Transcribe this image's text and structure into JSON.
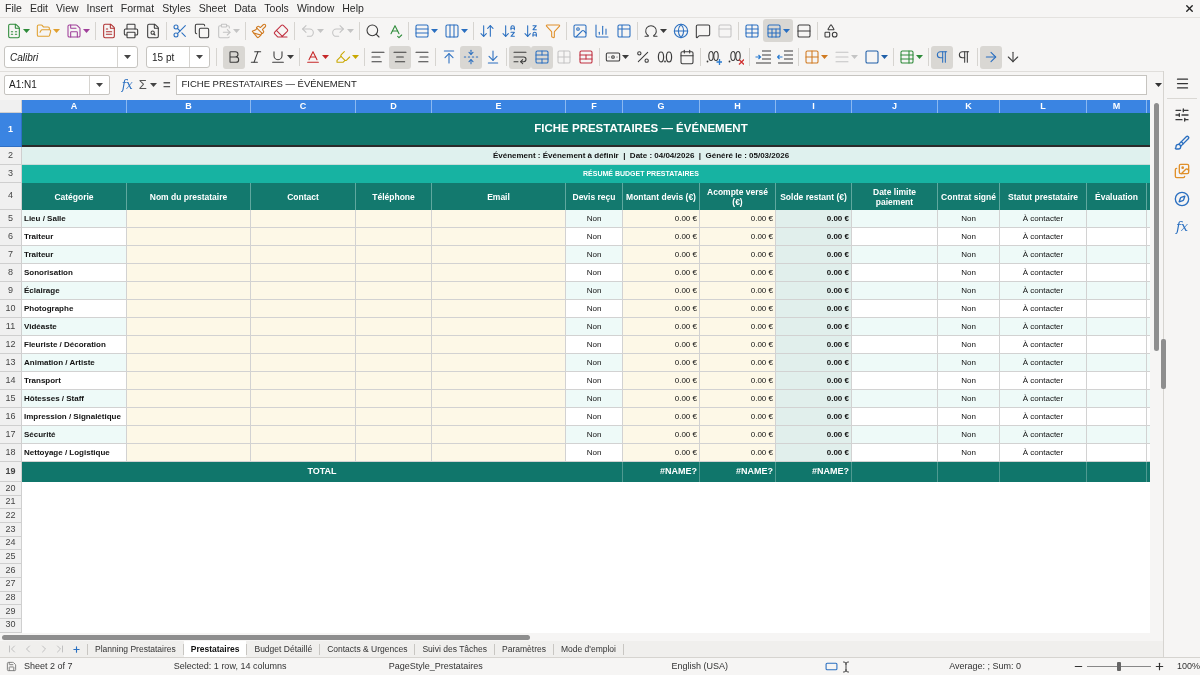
{
  "menu_bar": [
    "File",
    "Edit",
    "View",
    "Insert",
    "Format",
    "Styles",
    "Sheet",
    "Data",
    "Tools",
    "Window",
    "Help"
  ],
  "standard_toolbar": [
    {
      "pressed": false,
      "disabled": false
    },
    {
      "pressed": false,
      "disabled": false
    },
    {
      "pressed": false,
      "disabled": false
    },
    {
      "pressed": false,
      "disabled": false
    },
    {
      "pressed": false,
      "disabled": false
    },
    {
      "pressed": false,
      "disabled": false
    },
    {
      "pressed": false,
      "disabled": false
    },
    {
      "pressed": false,
      "disabled": false
    },
    {
      "pressed": false,
      "disabled": true
    },
    {
      "pressed": false,
      "disabled": false
    },
    {
      "pressed": false,
      "disabled": false
    },
    {
      "pressed": false,
      "disabled": true
    },
    {
      "pressed": false,
      "disabled": true
    },
    {
      "pressed": false,
      "disabled": false
    },
    {
      "pressed": false,
      "disabled": false
    },
    {
      "pressed": false,
      "disabled": false
    },
    {
      "pressed": false,
      "disabled": false
    },
    {
      "pressed": false,
      "disabled": false
    },
    {
      "pressed": false,
      "disabled": false
    },
    {
      "pressed": false,
      "disabled": false
    },
    {
      "pressed": false,
      "disabled": false
    },
    {
      "pressed": false,
      "disabled": false
    },
    {
      "pressed": false,
      "disabled": false
    },
    {
      "pressed": false,
      "disabled": false
    },
    {
      "pressed": false,
      "disabled": false
    },
    {
      "pressed": false,
      "disabled": false
    },
    {
      "pressed": false,
      "disabled": false
    },
    {
      "pressed": false,
      "disabled": true
    },
    {
      "pressed": false,
      "disabled": false
    },
    {
      "pressed": true,
      "disabled": false
    },
    {
      "pressed": false,
      "disabled": false
    },
    {
      "pressed": false,
      "disabled": false
    }
  ],
  "formatting_toolbar": {
    "font_name": "Calibri",
    "font_size": "15 pt",
    "buttons": [
      {
        "pressed": true,
        "disabled": false
      },
      {
        "pressed": false,
        "disabled": false
      },
      {
        "pressed": false,
        "disabled": false
      },
      {
        "pressed": false,
        "disabled": false
      },
      {
        "pressed": false,
        "disabled": false
      },
      {
        "pressed": false,
        "disabled": false
      },
      {
        "pressed": true,
        "disabled": false
      },
      {
        "pressed": false,
        "disabled": false
      },
      {
        "pressed": false,
        "disabled": false
      },
      {
        "pressed": true,
        "disabled": false
      },
      {
        "pressed": false,
        "disabled": false
      },
      {
        "pressed": true,
        "disabled": false
      },
      {
        "pressed": true,
        "disabled": false
      },
      {
        "pressed": false,
        "disabled": true
      },
      {
        "pressed": false,
        "disabled": false
      },
      {
        "pressed": false,
        "disabled": false
      },
      {
        "pressed": false,
        "disabled": false
      },
      {
        "pressed": false,
        "disabled": false
      },
      {
        "pressed": false,
        "disabled": false
      },
      {
        "pressed": false,
        "disabled": false
      },
      {
        "pressed": false,
        "disabled": false
      },
      {
        "pressed": false,
        "disabled": false
      },
      {
        "pressed": false,
        "disabled": false
      },
      {
        "pressed": false,
        "disabled": false
      },
      {
        "pressed": false,
        "disabled": true
      },
      {
        "pressed": false,
        "disabled": false
      },
      {
        "pressed": false,
        "disabled": false
      },
      {
        "pressed": true,
        "disabled": false
      },
      {
        "pressed": false,
        "disabled": false
      },
      {
        "pressed": true,
        "disabled": false
      },
      {
        "pressed": false,
        "disabled": false
      }
    ]
  },
  "formula_bar": {
    "name_box": "A1:N1",
    "function_wizard": "fx",
    "sum": "Σ",
    "equals": "=",
    "content": "FICHE PRESTATAIRES — ÉVÉNEMENT"
  },
  "columns": [
    {
      "label": "A",
      "selected": true
    },
    {
      "label": "B",
      "selected": true
    },
    {
      "label": "C",
      "selected": true
    },
    {
      "label": "D",
      "selected": true
    },
    {
      "label": "E",
      "selected": true
    },
    {
      "label": "F",
      "selected": true
    },
    {
      "label": "G",
      "selected": true
    },
    {
      "label": "H",
      "selected": true
    },
    {
      "label": "I",
      "selected": true
    },
    {
      "label": "J",
      "selected": true
    },
    {
      "label": "K",
      "selected": true
    },
    {
      "label": "L",
      "selected": true
    },
    {
      "label": "M",
      "selected": true
    }
  ],
  "row_headers": [
    {
      "label": "1",
      "selected": true
    },
    {
      "label": "2",
      "selected": false
    },
    {
      "label": "3",
      "selected": false
    },
    {
      "label": "4",
      "selected": false
    },
    {
      "label": "5",
      "selected": false
    },
    {
      "label": "6",
      "selected": false
    },
    {
      "label": "7",
      "selected": false
    },
    {
      "label": "8",
      "selected": false
    },
    {
      "label": "9",
      "selected": false
    },
    {
      "label": "10",
      "selected": false
    },
    {
      "label": "11",
      "selected": false
    },
    {
      "label": "12",
      "selected": false
    },
    {
      "label": "13",
      "selected": false
    },
    {
      "label": "14",
      "selected": false
    },
    {
      "label": "15",
      "selected": false
    },
    {
      "label": "16",
      "selected": false
    },
    {
      "label": "17",
      "selected": false
    },
    {
      "label": "18",
      "selected": false
    },
    {
      "label": "19",
      "selected": false
    },
    {
      "label": "20",
      "selected": false
    },
    {
      "label": "21",
      "selected": false
    },
    {
      "label": "22",
      "selected": false
    },
    {
      "label": "23",
      "selected": false
    },
    {
      "label": "24",
      "selected": false
    },
    {
      "label": "25",
      "selected": false
    },
    {
      "label": "26",
      "selected": false
    },
    {
      "label": "27",
      "selected": false
    },
    {
      "label": "28",
      "selected": false
    },
    {
      "label": "29",
      "selected": false
    },
    {
      "label": "30",
      "selected": false
    }
  ],
  "sheet": {
    "title": "FICHE PRESTATAIRES — ÉVÉNEMENT",
    "info": "Événement : Événement à définir  |  Date : 04/04/2026  |  Généré le : 05/03/2026",
    "section": "RÉSUMÉ BUDGET PRESTATAIRES",
    "headers": [
      "Catégorie",
      "Nom du prestataire",
      "Contact",
      "Téléphone",
      "Email",
      "Devis reçu",
      "Montant devis (€)",
      "Acompte versé (€)",
      "Solde restant (€)",
      "Date limite paiement",
      "Contrat signé",
      "Statut prestataire",
      "Évaluation"
    ],
    "vendors": [
      {
        "category": "Lieu / Salle",
        "quote_received": "Non",
        "quote_amount": "0.00 €",
        "deposit_paid": "0.00 €",
        "balance": "0.00 €",
        "contract_signed": "Non",
        "status": "À contacter"
      },
      {
        "category": "Traiteur",
        "quote_received": "Non",
        "quote_amount": "0.00 €",
        "deposit_paid": "0.00 €",
        "balance": "0.00 €",
        "contract_signed": "Non",
        "status": "À contacter"
      },
      {
        "category": "Traiteur",
        "quote_received": "Non",
        "quote_amount": "0.00 €",
        "deposit_paid": "0.00 €",
        "balance": "0.00 €",
        "contract_signed": "Non",
        "status": "À contacter"
      },
      {
        "category": "Sonorisation",
        "quote_received": "Non",
        "quote_amount": "0.00 €",
        "deposit_paid": "0.00 €",
        "balance": "0.00 €",
        "contract_signed": "Non",
        "status": "À contacter"
      },
      {
        "category": "Éclairage",
        "quote_received": "Non",
        "quote_amount": "0.00 €",
        "deposit_paid": "0.00 €",
        "balance": "0.00 €",
        "contract_signed": "Non",
        "status": "À contacter"
      },
      {
        "category": "Photographe",
        "quote_received": "Non",
        "quote_amount": "0.00 €",
        "deposit_paid": "0.00 €",
        "balance": "0.00 €",
        "contract_signed": "Non",
        "status": "À contacter"
      },
      {
        "category": "Vidéaste",
        "quote_received": "Non",
        "quote_amount": "0.00 €",
        "deposit_paid": "0.00 €",
        "balance": "0.00 €",
        "contract_signed": "Non",
        "status": "À contacter"
      },
      {
        "category": "Fleuriste / Décoration",
        "quote_received": "Non",
        "quote_amount": "0.00 €",
        "deposit_paid": "0.00 €",
        "balance": "0.00 €",
        "contract_signed": "Non",
        "status": "À contacter"
      },
      {
        "category": "Animation / Artiste",
        "quote_received": "Non",
        "quote_amount": "0.00 €",
        "deposit_paid": "0.00 €",
        "balance": "0.00 €",
        "contract_signed": "Non",
        "status": "À contacter"
      },
      {
        "category": "Transport",
        "quote_received": "Non",
        "quote_amount": "0.00 €",
        "deposit_paid": "0.00 €",
        "balance": "0.00 €",
        "contract_signed": "Non",
        "status": "À contacter"
      },
      {
        "category": "Hôtesses / Staff",
        "quote_received": "Non",
        "quote_amount": "0.00 €",
        "deposit_paid": "0.00 €",
        "balance": "0.00 €",
        "contract_signed": "Non",
        "status": "À contacter"
      },
      {
        "category": "Impression / Signalétique",
        "quote_received": "Non",
        "quote_amount": "0.00 €",
        "deposit_paid": "0.00 €",
        "balance": "0.00 €",
        "contract_signed": "Non",
        "status": "À contacter"
      },
      {
        "category": "Sécurité",
        "quote_received": "Non",
        "quote_amount": "0.00 €",
        "deposit_paid": "0.00 €",
        "balance": "0.00 €",
        "contract_signed": "Non",
        "status": "À contacter"
      },
      {
        "category": "Nettoyage / Logistique",
        "quote_received": "Non",
        "quote_amount": "0.00 €",
        "deposit_paid": "0.00 €",
        "balance": "0.00 €",
        "contract_signed": "Non",
        "status": "À contacter"
      }
    ],
    "total": {
      "label": "TOTAL",
      "quote_amount": "#NAME?",
      "deposit_paid": "#NAME?",
      "balance": "#NAME?"
    }
  },
  "sheet_tabs": [
    {
      "label": "Planning Prestataires",
      "selected": false
    },
    {
      "label": "Prestataires",
      "selected": true
    },
    {
      "label": "Budget Détaillé",
      "selected": false
    },
    {
      "label": "Contacts & Urgences",
      "selected": false
    },
    {
      "label": "Suivi des Tâches",
      "selected": false
    },
    {
      "label": "Paramètres",
      "selected": false
    },
    {
      "label": "Mode d'emploi",
      "selected": false
    }
  ],
  "sidebar": {
    "functions": "fx"
  },
  "status_bar": {
    "sheet": "Sheet 2 of 7",
    "selection": "Selected: 1 row, 14 columns",
    "page_style": "PageStyle_Prestataires",
    "language": "English (USA)",
    "statistics": "Average: ; Sum: 0",
    "zoom_slider": {
      "level": 0.5
    },
    "zoom": "100%"
  }
}
